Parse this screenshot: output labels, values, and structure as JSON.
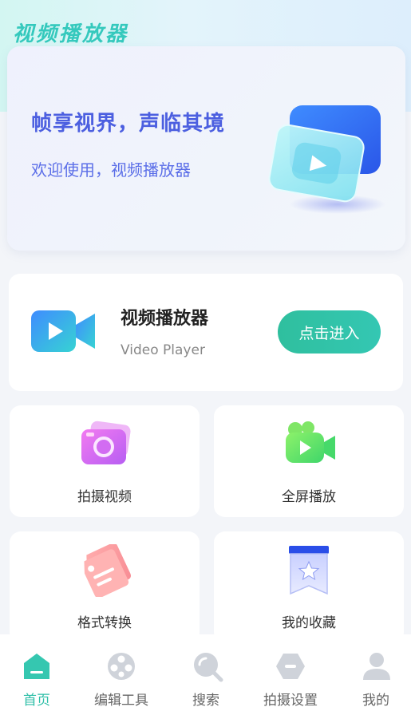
{
  "app": {
    "title": "视频播放器"
  },
  "banner": {
    "headline": "帧享视界，声临其境",
    "subtitle": "欢迎使用，视频播放器",
    "art_icon": "play-card-illustration"
  },
  "player_card": {
    "title": "视频播放器",
    "subtitle": "Video Player",
    "button_label": "点击进入",
    "icon": "video-camera-icon"
  },
  "features": [
    {
      "label": "拍摄视频",
      "icon": "camera-icon"
    },
    {
      "label": "全屏播放",
      "icon": "video-play-icon"
    },
    {
      "label": "格式转换",
      "icon": "tag-icon"
    },
    {
      "label": "我的收藏",
      "icon": "bookmark-star-icon"
    }
  ],
  "nav": {
    "active_color": "#2fbfa8",
    "items": [
      {
        "label": "首页",
        "icon": "home-icon",
        "active": true
      },
      {
        "label": "编辑工具",
        "icon": "film-reel-icon",
        "active": false
      },
      {
        "label": "搜索",
        "icon": "search-icon",
        "active": false
      },
      {
        "label": "拍摄设置",
        "icon": "hexagon-settings-icon",
        "active": false
      },
      {
        "label": "我的",
        "icon": "user-icon",
        "active": false
      }
    ]
  },
  "colors": {
    "accent": "#34c7b3",
    "headline": "#4c5fe0",
    "inactive_icon": "#cfd3da"
  }
}
